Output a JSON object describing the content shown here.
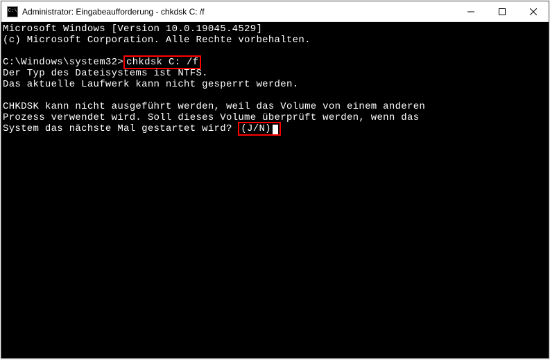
{
  "window": {
    "title": "Administrator: Eingabeaufforderung - chkdsk  C: /f",
    "icon_text": "C:\\"
  },
  "terminal": {
    "line1": "Microsoft Windows [Version 10.0.19045.4529]",
    "line2": "(c) Microsoft Corporation. Alle Rechte vorbehalten.",
    "blank1": "",
    "prompt": "C:\\Windows\\system32>",
    "command": "chkdsk C: /f",
    "fs_type": "Der Typ des Dateisystems ist NTFS.",
    "lock_err": "Das aktuelle Laufwerk kann nicht gesperrt werden.",
    "blank2": "",
    "msg1": "CHKDSK kann nicht ausgeführt werden, weil das Volume von einem anderen",
    "msg2": "Prozess verwendet wird. Soll dieses Volume überprüft werden, wenn das",
    "msg3a": "System das nächste Mal gestartet wird? ",
    "msg3b": "(J/N)"
  }
}
